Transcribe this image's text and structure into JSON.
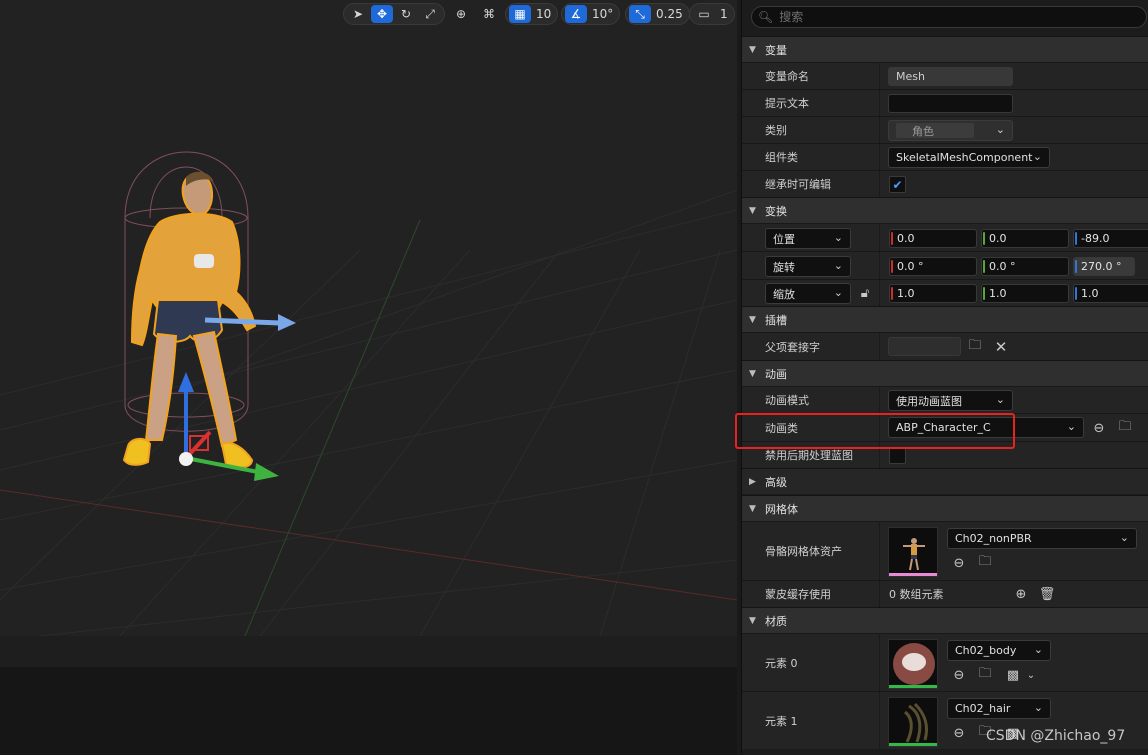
{
  "toolbar": {
    "grid_snap": "10",
    "rotation_snap": "10°",
    "scale_snap": "0.25",
    "camera_speed": "1"
  },
  "search": {
    "placeholder": "搜索"
  },
  "sections": {
    "variable": "变量",
    "transform": "变换",
    "sockets": "插槽",
    "animation": "动画",
    "advanced": "高级",
    "mesh": "网格体",
    "materials": "材质"
  },
  "variable": {
    "name_label": "变量命名",
    "name_value": "Mesh",
    "tooltip_label": "提示文本",
    "tooltip_value": "",
    "category_label": "类别",
    "category_value": "角色",
    "component_class_label": "组件类",
    "component_class_value": "SkeletalMeshComponent",
    "editable_inherit_label": "继承时可编辑"
  },
  "transform": {
    "location_label": "位置",
    "location": [
      "0.0",
      "0.0",
      "-89.0"
    ],
    "rotation_label": "旋转",
    "rotation": [
      "0.0 °",
      "0.0 °",
      "270.0 °"
    ],
    "scale_label": "缩放",
    "scale": [
      "1.0",
      "1.0",
      "1.0"
    ]
  },
  "sockets": {
    "parent_socket_label": "父项套接字"
  },
  "animation": {
    "mode_label": "动画模式",
    "mode_value": "使用动画蓝图",
    "class_label": "动画类",
    "class_value": "ABP_Character_C",
    "disable_post_label": "禁用后期处理蓝图"
  },
  "mesh": {
    "skeletal_mesh_label": "骨骼网格体资产",
    "skeletal_mesh_value": "Ch02_nonPBR",
    "skin_cache_label": "蒙皮缓存使用",
    "skin_cache_value": "0 数组元素"
  },
  "materials": {
    "element0_label": "元素 0",
    "element0_value": "Ch02_body",
    "element1_label": "元素 1",
    "element1_value": "Ch02_hair"
  },
  "watermark": "CSDN @Zhichao_97",
  "colors": {
    "accent": "#1f6ad9",
    "highlight_box": "#e8231f",
    "selection_outline": "#f2a21e"
  }
}
